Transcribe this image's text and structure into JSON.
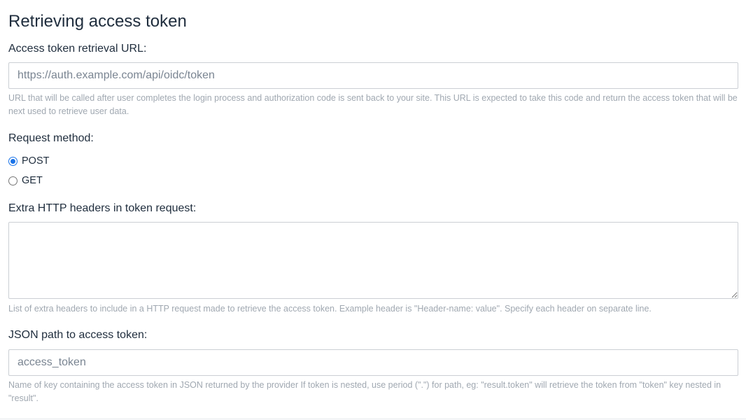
{
  "section": {
    "title": "Retrieving access token"
  },
  "token_url": {
    "label": "Access token retrieval URL:",
    "value": "",
    "placeholder": "https://auth.example.com/api/oidc/token",
    "help": "URL that will be called after user completes the login process and authorization code is sent back to your site. This URL is expected to take this code and return the access token that will be next used to retrieve user data."
  },
  "request_method": {
    "label": "Request method:",
    "options": [
      {
        "label": "POST",
        "checked": true
      },
      {
        "label": "GET",
        "checked": false
      }
    ],
    "accent_color": "#1a73e8"
  },
  "extra_headers": {
    "label": "Extra HTTP headers in token request:",
    "value": "",
    "help": "List of extra headers to include in a HTTP request made to retrieve the access token. Example header is \"Header-name: value\". Specify each header on separate line."
  },
  "json_path": {
    "label": "JSON path to access token:",
    "value": "",
    "placeholder": "access_token",
    "help": "Name of key containing the access token in JSON returned by the provider If token is nested, use period (\".\") for path, eg: \"result.token\" will retrieve the token from \"token\" key nested in \"result\"."
  }
}
